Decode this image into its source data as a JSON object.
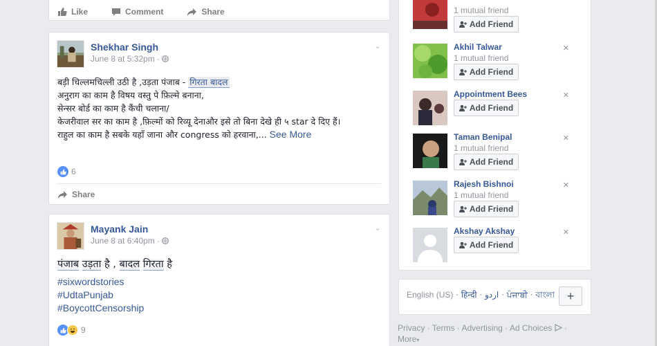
{
  "top_actions": {
    "like": "Like",
    "comment": "Comment",
    "share": "Share"
  },
  "posts": [
    {
      "author": "Shekhar Singh",
      "timestamp": "June 8 at 5:32pm",
      "lines": [
        "बड़ी चिल्लमचिल्ली उठी है ,उड़ता पंजाब - ",
        "अनुराग का काम है विषय वस्तु पे फ़िल्मे बनाना,",
        "सेन्सर बोर्ड का काम है कैंची चलाना/",
        "केजरीवाल सर का काम है ,फ़िल्मों को रिव्यू देनाऔर इसे तो बिना देखे ही ५ star दे दिए हैं।",
        "राहुल का काम है सबके यहाँ जाना और congress को हरवाना,... "
      ],
      "highlight": "गिरता बादल",
      "see_more": "See More",
      "reaction_count": "6",
      "share": "Share"
    },
    {
      "author": "Mayank Jain",
      "timestamp": "June 8 at 6:40pm",
      "big_text": {
        "w1": "पंजाब",
        "w2": "उड़ता",
        "mid": "है ,",
        "w3": "बादल",
        "w4": "गिरता",
        "end": "है"
      },
      "hashtags": [
        "#sixwordstories",
        "#UdtaPunjab",
        "#BoycottCensorship"
      ],
      "reaction_count": "9"
    }
  ],
  "people_you_may_know": [
    {
      "name": "",
      "mutual": "1 mutual friend",
      "button": "Add Friend"
    },
    {
      "name": "Akhil Talwar",
      "mutual": "1 mutual friend",
      "button": "Add Friend"
    },
    {
      "name": "Appointment Bees",
      "mutual": "",
      "button": "Add Friend"
    },
    {
      "name": "Taman Benipal",
      "mutual": "1 mutual friend",
      "button": "Add Friend"
    },
    {
      "name": "Rajesh Bishnoi",
      "mutual": "1 mutual friend",
      "button": "Add Friend"
    },
    {
      "name": "Akshay Akshay",
      "mutual": "",
      "button": "Add Friend"
    }
  ],
  "languages": {
    "current": "English (US)",
    "others": [
      "हिन्दी",
      "اردو",
      "ਪੰਜਾਬੀ",
      "বাংলা"
    ],
    "add": "+"
  },
  "footer": {
    "privacy": "Privacy",
    "terms": "Terms",
    "advertising": "Advertising",
    "ad_choices": "Ad Choices",
    "more": "More"
  },
  "colors": {
    "link": "#365899",
    "background": "#e9ebee",
    "like_blue": "#5890ff"
  }
}
